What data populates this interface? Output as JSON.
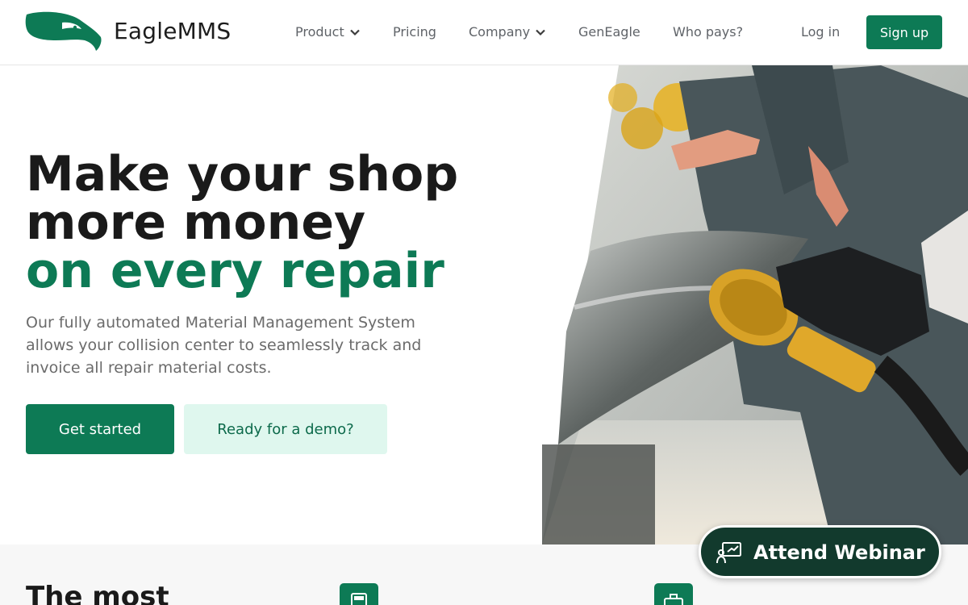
{
  "header": {
    "brand": "EagleMMS",
    "nav": {
      "product": "Product",
      "pricing": "Pricing",
      "company": "Company",
      "geneagle": "GenEagle",
      "who_pays": "Who pays?"
    },
    "login": "Log in",
    "signup": "Sign up"
  },
  "hero": {
    "headline_line1": "Make your shop",
    "headline_line2": "more money",
    "headline_line3": "on every repair",
    "subtext": "Our fully automated Material Management System allows your collision center to seamlessly track and invoice all repair material costs.",
    "cta_primary": "Get started",
    "cta_secondary": "Ready for a demo?"
  },
  "lower": {
    "title": "The most"
  },
  "webinar": {
    "label": "Attend Webinar"
  },
  "colors": {
    "brand_green": "#0d7a55",
    "secondary_bg": "#dff7ee",
    "webinar_bg": "#123a2d"
  },
  "icons": [
    "eagle-logo-icon",
    "chevron-down-icon",
    "calculator-icon",
    "briefcase-icon",
    "presentation-icon"
  ]
}
